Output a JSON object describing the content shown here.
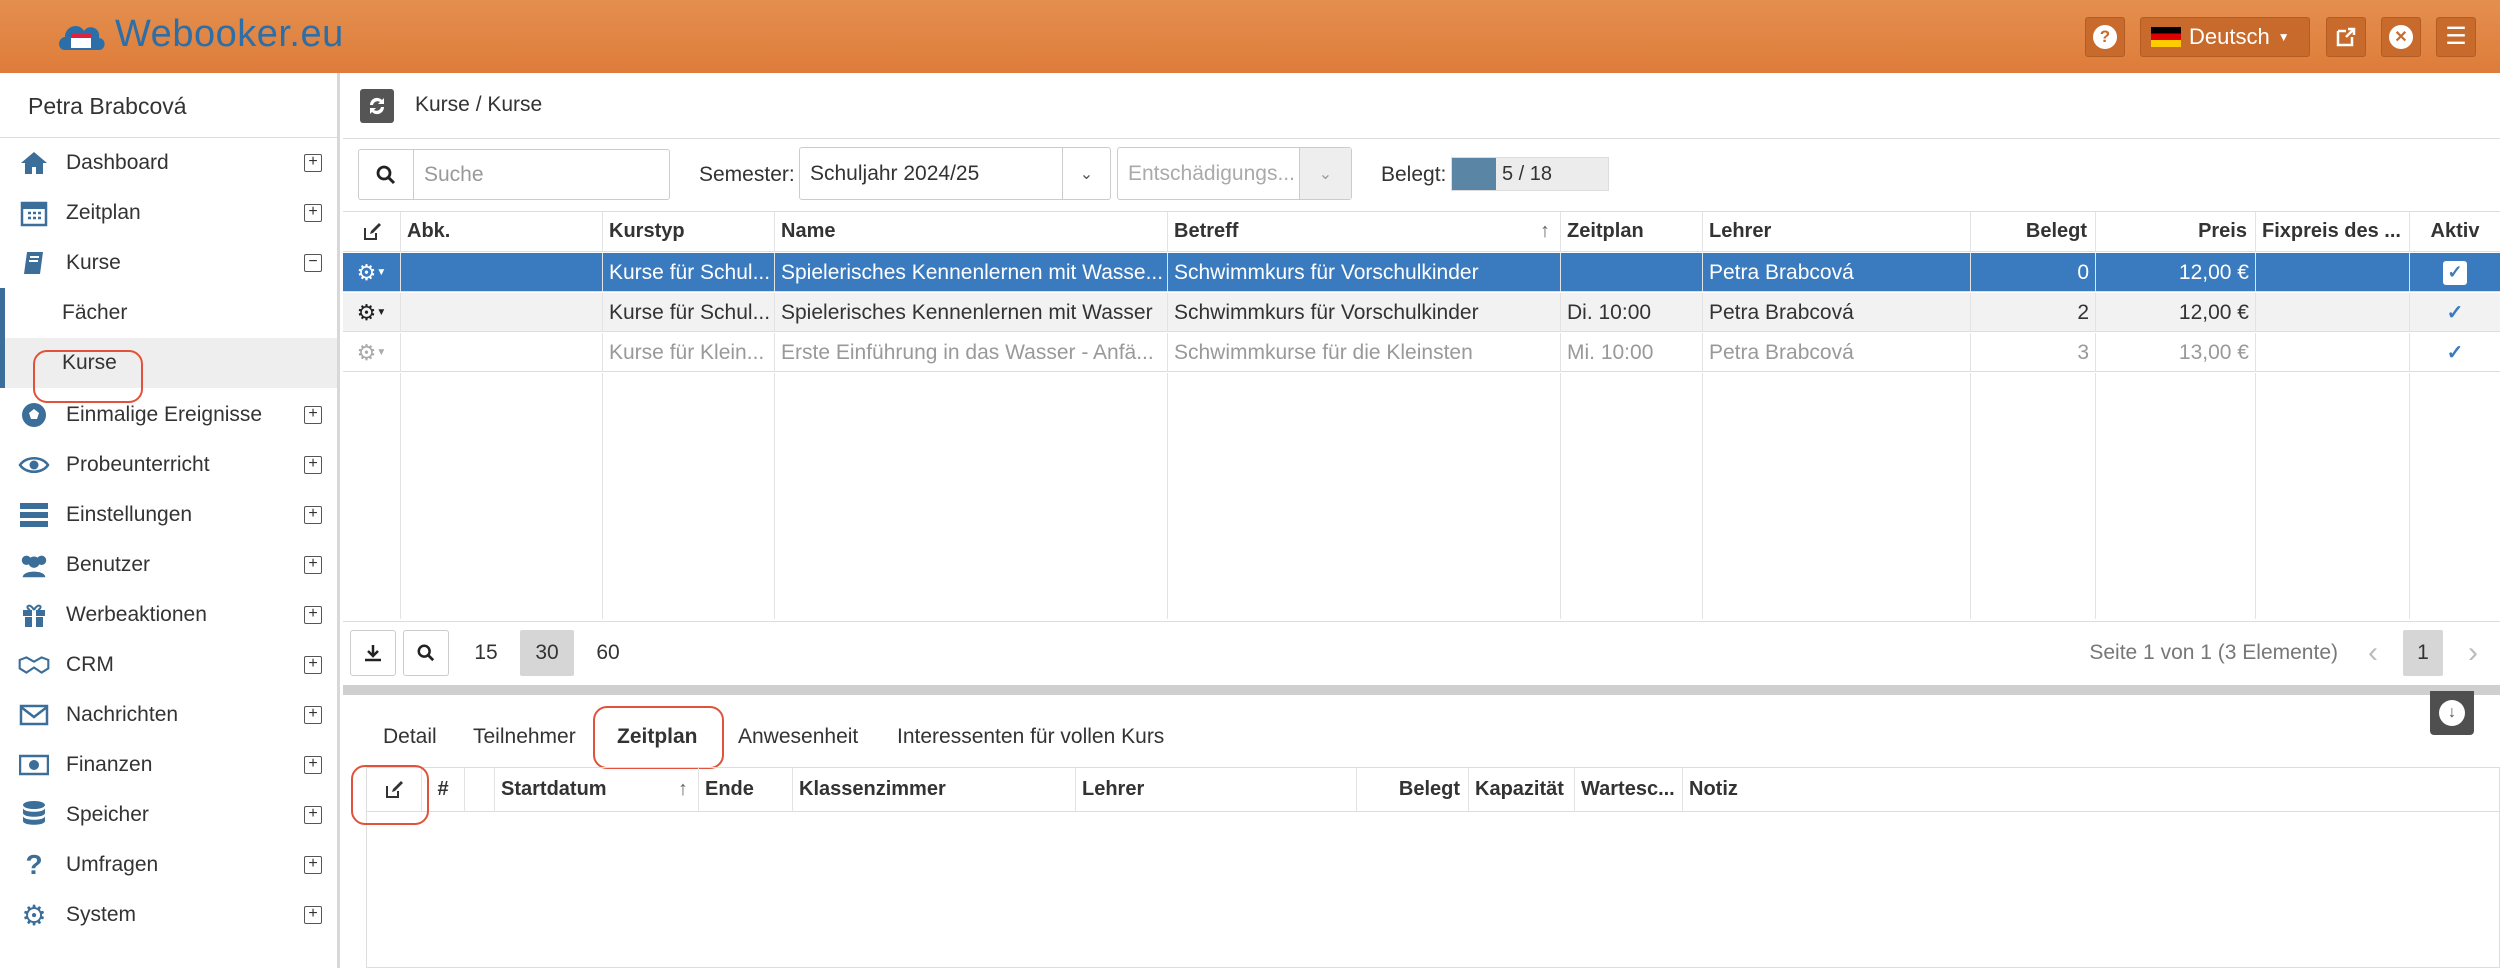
{
  "app": {
    "logo_text": "Webooker.eu",
    "language": "Deutsch"
  },
  "sidebar": {
    "user": "Petra Brabcová",
    "items": [
      {
        "label": "Dashboard",
        "icon": "home-icon"
      },
      {
        "label": "Zeitplan",
        "icon": "calendar-icon"
      },
      {
        "label": "Kurse",
        "icon": "book-icon"
      },
      {
        "label": "Einmalige Ereignisse",
        "icon": "soccer-ball-icon"
      },
      {
        "label": "Probeunterricht",
        "icon": "eye-icon"
      },
      {
        "label": "Einstellungen",
        "icon": "server-icon"
      },
      {
        "label": "Benutzer",
        "icon": "users-icon"
      },
      {
        "label": "Werbeaktionen",
        "icon": "gift-icon"
      },
      {
        "label": "CRM",
        "icon": "handshake-icon"
      },
      {
        "label": "Nachrichten",
        "icon": "envelope-icon"
      },
      {
        "label": "Finanzen",
        "icon": "money-icon"
      },
      {
        "label": "Speicher",
        "icon": "database-icon"
      },
      {
        "label": "Umfragen",
        "icon": "question-icon"
      },
      {
        "label": "System",
        "icon": "gears-icon"
      }
    ],
    "subitems": [
      {
        "label": "Fächer"
      },
      {
        "label": "Kurse"
      }
    ]
  },
  "breadcrumb": "Kurse / Kurse",
  "filters": {
    "search_placeholder": "Suche",
    "semester_label": "Semester:",
    "semester_value": "Schuljahr 2024/25",
    "compensation_placeholder": "Entschädigungs...",
    "occupied_label": "Belegt:",
    "occupied_value": "5 / 18",
    "occupied_fraction": 0.28
  },
  "table": {
    "headers": {
      "abk": "Abk.",
      "kurstyp": "Kurstyp",
      "name": "Name",
      "betreff": "Betreff",
      "zeitplan": "Zeitplan",
      "lehrer": "Lehrer",
      "belegt": "Belegt",
      "preis": "Preis",
      "fixpreis": "Fixpreis des ...",
      "aktiv": "Aktiv"
    },
    "rows": [
      {
        "abk": "",
        "kurstyp": "Kurse für Schul...",
        "name": "Spielerisches Kennenlernen mit Wasse...",
        "betreff": "Schwimmkurs für Vorschulkinder",
        "zeitplan": "",
        "lehrer": "Petra Brabcová",
        "belegt": "0",
        "preis": "12,00 €",
        "fixpreis": "",
        "aktiv": true
      },
      {
        "abk": "",
        "kurstyp": "Kurse für Schul...",
        "name": "Spielerisches Kennenlernen mit Wasser",
        "betreff": "Schwimmkurs für Vorschulkinder",
        "zeitplan": "Di. 10:00",
        "lehrer": "Petra Brabcová",
        "belegt": "2",
        "preis": "12,00 €",
        "fixpreis": "",
        "aktiv": true
      },
      {
        "abk": "",
        "kurstyp": "Kurse für Klein...",
        "name": "Erste Einführung in das Wasser - Anfä...",
        "betreff": "Schwimmkurse für die Kleinsten",
        "zeitplan": "Mi. 10:00",
        "lehrer": "Petra Brabcová",
        "belegt": "3",
        "preis": "13,00 €",
        "fixpreis": "",
        "aktiv": true
      }
    ]
  },
  "pager": {
    "sizes": [
      "15",
      "30",
      "60"
    ],
    "info": "Seite 1 von 1 (3 Elemente)",
    "page": "1"
  },
  "tabs": [
    "Detail",
    "Teilnehmer",
    "Zeitplan",
    "Anwesenheit",
    "Interessenten für vollen Kurs"
  ],
  "schedule": {
    "headers": {
      "num": "#",
      "start": "Startdatum",
      "end": "Ende",
      "room": "Klassenzimmer",
      "teacher": "Lehrer",
      "belegt": "Belegt",
      "capacity": "Kapazität",
      "waitlist": "Wartesc...",
      "note": "Notiz"
    }
  }
}
